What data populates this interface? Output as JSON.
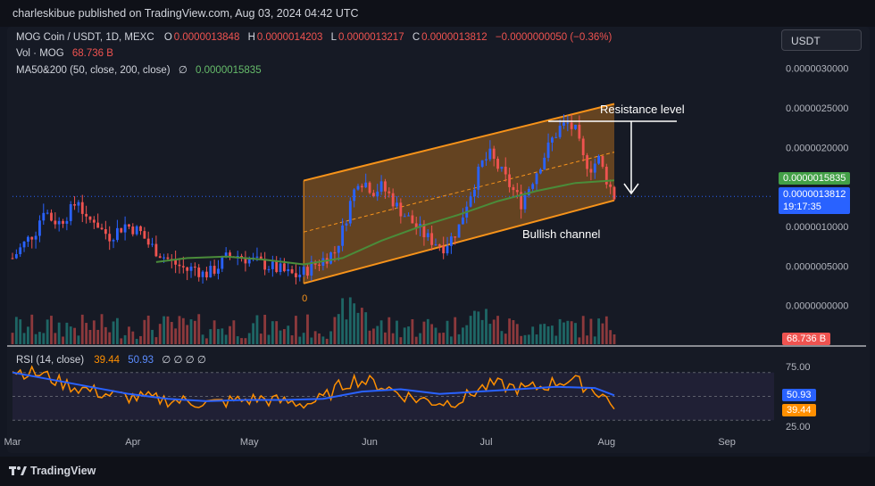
{
  "header": {
    "published_text": "charleskibue published on TradingView.com, Aug 03, 2024 04:42 UTC"
  },
  "legend": {
    "symbol": "MOG Coin / USDT, 1D, MEXC",
    "open_label": "O",
    "open": "0.0000013848",
    "high_label": "H",
    "high": "0.0000014203",
    "low_label": "L",
    "low": "0.0000013217",
    "close_label": "C",
    "close": "0.0000013812",
    "change": "−0.0000000050 (−0.36%)",
    "vol_label": "Vol · MOG",
    "vol_value": "68.736 B",
    "ma_label": "MA50&200 (50, close, 200, close)",
    "ma_symbol": "∅",
    "ma_value": "0.0000015835"
  },
  "toolbar": {
    "currency_label": "USDT"
  },
  "rsi_legend": {
    "label": "RSI (14, close)",
    "rsi_value": "39.44",
    "ma_value": "50.93",
    "extra": "∅ ∅ ∅ ∅"
  },
  "tags": {
    "ma": "0.0000015835",
    "price": "0.0000013812",
    "countdown": "19:17:35",
    "volume": "68.736 B",
    "rsi_ma": "50.93",
    "rsi": "39.44"
  },
  "annotations": {
    "resistance": "Resistance level",
    "channel": "Bullish channel",
    "zero_label": "0"
  },
  "footer": {
    "brand": "TradingView"
  },
  "colors": {
    "up": "#2962ff",
    "down": "#ef5350",
    "ma": "#4a8c3a",
    "channel": "#f7931a",
    "rsi": "#ff8f00",
    "rsi_ma": "#2962ff",
    "vol_up": "#26a69a",
    "vol_down": "#ef5350"
  },
  "chart_data": {
    "type": "candlestick",
    "y_axis": {
      "min": -5e-07,
      "max": 3.3e-06,
      "ticks": [
        "0.0000030000",
        "0.0000025000",
        "0.0000020000",
        "0.0000010000",
        "0.0000005000",
        "0.0000000000"
      ],
      "tick_values": [
        3e-06,
        2.5e-06,
        2e-06,
        1e-06,
        5e-07,
        0.0
      ]
    },
    "x_axis": {
      "labels": [
        "Mar",
        "Apr",
        "May",
        "Jun",
        "Jul",
        "Aug",
        "Sep"
      ],
      "label_days": [
        0,
        31,
        61,
        92,
        122,
        153,
        184
      ],
      "last_day": 155
    },
    "close_path": [
      [
        0,
        0.6
      ],
      [
        3,
        0.78
      ],
      [
        6,
        0.95
      ],
      [
        8,
        1.23
      ],
      [
        10,
        1.1
      ],
      [
        12,
        1.05
      ],
      [
        15,
        1.2
      ],
      [
        17,
        1.35
      ],
      [
        19,
        1.05
      ],
      [
        21,
        1.1
      ],
      [
        23,
        0.95
      ],
      [
        25,
        0.88
      ],
      [
        27,
        0.95
      ],
      [
        29,
        1.02
      ],
      [
        31,
        0.98
      ],
      [
        33,
        0.92
      ],
      [
        35,
        0.78
      ],
      [
        37,
        0.7
      ],
      [
        39,
        0.62
      ],
      [
        41,
        0.55
      ],
      [
        43,
        0.5
      ],
      [
        45,
        0.45
      ],
      [
        47,
        0.48
      ],
      [
        49,
        0.4
      ],
      [
        51,
        0.42
      ],
      [
        53,
        0.5
      ],
      [
        55,
        0.6
      ],
      [
        57,
        0.65
      ],
      [
        59,
        0.62
      ],
      [
        61,
        0.58
      ],
      [
        63,
        0.55
      ],
      [
        65,
        0.52
      ],
      [
        67,
        0.48
      ],
      [
        69,
        0.45
      ],
      [
        71,
        0.4
      ],
      [
        73,
        0.38
      ],
      [
        75,
        0.42
      ],
      [
        77,
        0.5
      ],
      [
        79,
        0.55
      ],
      [
        81,
        0.62
      ],
      [
        83,
        0.68
      ],
      [
        85,
        0.95
      ],
      [
        87,
        1.3
      ],
      [
        89,
        1.6
      ],
      [
        91,
        1.55
      ],
      [
        93,
        1.45
      ],
      [
        95,
        1.5
      ],
      [
        97,
        1.4
      ],
      [
        99,
        1.25
      ],
      [
        101,
        1.15
      ],
      [
        103,
        1.05
      ],
      [
        105,
        0.95
      ],
      [
        107,
        0.85
      ],
      [
        109,
        0.8
      ],
      [
        111,
        0.75
      ],
      [
        113,
        0.85
      ],
      [
        115,
        1.0
      ],
      [
        117,
        1.3
      ],
      [
        119,
        1.55
      ],
      [
        121,
        1.8
      ],
      [
        123,
        1.9
      ],
      [
        125,
        1.75
      ],
      [
        127,
        1.6
      ],
      [
        129,
        1.45
      ],
      [
        131,
        1.3
      ],
      [
        133,
        1.5
      ],
      [
        135,
        1.7
      ],
      [
        137,
        1.9
      ],
      [
        139,
        2.1
      ],
      [
        141,
        2.25
      ],
      [
        143,
        2.3
      ],
      [
        145,
        2.2
      ],
      [
        147,
        1.85
      ],
      [
        149,
        1.75
      ],
      [
        151,
        1.85
      ],
      [
        153,
        1.6
      ],
      [
        155,
        1.38
      ]
    ],
    "ma50_path": [
      [
        37,
        0.55
      ],
      [
        45,
        0.6
      ],
      [
        55,
        0.62
      ],
      [
        65,
        0.58
      ],
      [
        75,
        0.52
      ],
      [
        85,
        0.6
      ],
      [
        95,
        0.82
      ],
      [
        105,
        1.0
      ],
      [
        115,
        1.15
      ],
      [
        125,
        1.32
      ],
      [
        135,
        1.45
      ],
      [
        145,
        1.55
      ],
      [
        155,
        1.5835
      ]
    ],
    "channel": {
      "upper": [
        [
          75,
          1.58
        ],
        [
          155,
          2.55
        ]
      ],
      "lower": [
        [
          75,
          0.28
        ],
        [
          155,
          1.33
        ]
      ]
    },
    "resistance_level": 2.33,
    "rsi": {
      "range": [
        25,
        75
      ],
      "ticks": [
        "75.00",
        "25.00"
      ],
      "rsi_path": [
        [
          0,
          72
        ],
        [
          4,
          70
        ],
        [
          8,
          68
        ],
        [
          12,
          62
        ],
        [
          16,
          58
        ],
        [
          20,
          55
        ],
        [
          24,
          52
        ],
        [
          28,
          50
        ],
        [
          32,
          49
        ],
        [
          36,
          48
        ],
        [
          40,
          47
        ],
        [
          44,
          46
        ],
        [
          48,
          45
        ],
        [
          52,
          44
        ],
        [
          56,
          46
        ],
        [
          60,
          47
        ],
        [
          64,
          48
        ],
        [
          68,
          46
        ],
        [
          72,
          45
        ],
        [
          76,
          44
        ],
        [
          80,
          48
        ],
        [
          84,
          58
        ],
        [
          88,
          64
        ],
        [
          92,
          62
        ],
        [
          96,
          58
        ],
        [
          100,
          52
        ],
        [
          104,
          48
        ],
        [
          108,
          46
        ],
        [
          112,
          45
        ],
        [
          116,
          48
        ],
        [
          120,
          56
        ],
        [
          124,
          60
        ],
        [
          128,
          58
        ],
        [
          132,
          56
        ],
        [
          136,
          58
        ],
        [
          140,
          62
        ],
        [
          144,
          64
        ],
        [
          148,
          58
        ],
        [
          152,
          52
        ],
        [
          155,
          39.44
        ]
      ],
      "ma_path": [
        [
          0,
          70
        ],
        [
          10,
          64
        ],
        [
          20,
          58
        ],
        [
          30,
          52
        ],
        [
          40,
          48
        ],
        [
          50,
          46
        ],
        [
          60,
          47
        ],
        [
          70,
          47
        ],
        [
          80,
          48
        ],
        [
          90,
          54
        ],
        [
          100,
          56
        ],
        [
          110,
          52
        ],
        [
          120,
          54
        ],
        [
          130,
          56
        ],
        [
          140,
          58
        ],
        [
          150,
          57
        ],
        [
          155,
          50.93
        ]
      ]
    }
  }
}
